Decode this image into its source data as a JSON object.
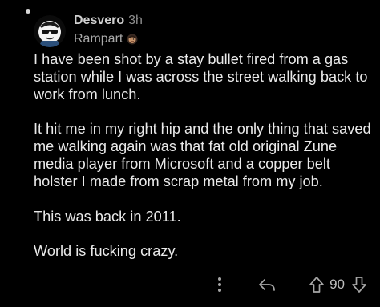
{
  "comment": {
    "author": "Desvero",
    "time": "3h",
    "flair": "Rampart",
    "paragraphs": [
      "I have been shot by a stay bullet fired from a gas station while I was across the street walking back to work from lunch.",
      "It hit me in my right hip and the only thing that saved me walking again was that fat old original Zune media player from Microsoft and a copper belt holster I made from scrap metal from my job.",
      "This was back in 2011.",
      "World is fucking crazy."
    ],
    "score": "90"
  },
  "icons": {
    "avatar": "cartoon-avatar-with-sunglasses",
    "flair": "rampart-face-icon",
    "more": "more-vertical-icon",
    "reply": "reply-icon",
    "upvote": "upvote-arrow-icon",
    "downvote": "downvote-arrow-icon"
  },
  "colors": {
    "background": "#000000",
    "text": "#e9e9e9",
    "muted": "#8e8e8e"
  }
}
